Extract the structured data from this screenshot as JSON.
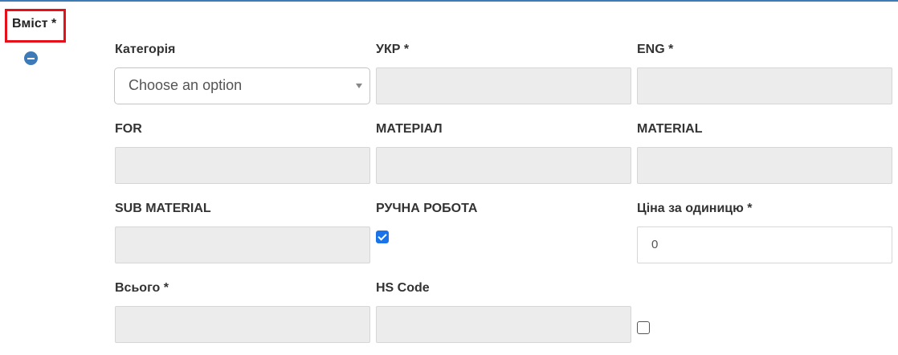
{
  "section": {
    "title": "Вміст *"
  },
  "fields": {
    "category": {
      "label": "Категорія",
      "placeholder": "Choose an option"
    },
    "ukr": {
      "label": "УКР *",
      "value": ""
    },
    "eng": {
      "label": "ENG *",
      "value": ""
    },
    "for": {
      "label": "FOR",
      "value": ""
    },
    "material_ukr": {
      "label": "МАТЕРІАЛ",
      "value": ""
    },
    "material": {
      "label": "MATERIAL",
      "value": ""
    },
    "sub_material": {
      "label": "SUB MATERIAL",
      "value": ""
    },
    "handmade": {
      "label": "РУЧНА РОБОТА",
      "checked": true
    },
    "unit_price": {
      "label": "Ціна за одиницю *",
      "value": "0"
    },
    "total": {
      "label": "Всього *",
      "value": ""
    },
    "hs_code": {
      "label": "HS Code",
      "value": ""
    },
    "extra_checkbox": {
      "checked": false
    }
  },
  "colors": {
    "accent": "#3d7ab8",
    "highlight_border": "#e5101a",
    "checkbox_blue": "#1a73e8",
    "disabled_bg": "#ececec"
  },
  "icons": {
    "remove": "minus-circle-icon",
    "select_arrow": "caret-down-icon"
  }
}
